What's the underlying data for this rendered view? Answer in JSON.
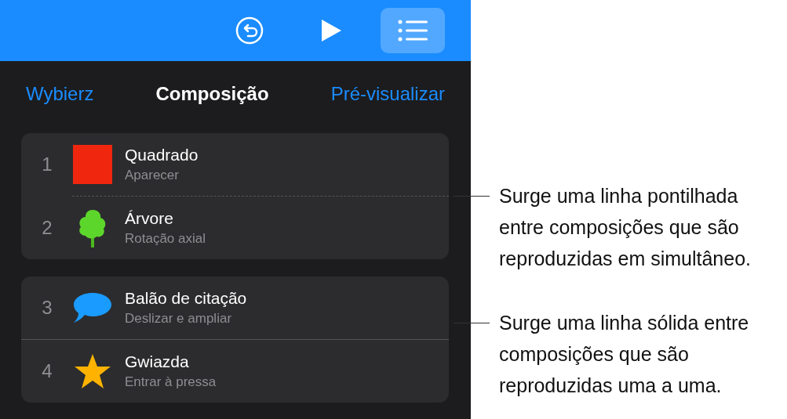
{
  "toolbar": {
    "buttons": [
      {
        "kind": "undo",
        "selected": false
      },
      {
        "kind": "play",
        "selected": false
      },
      {
        "kind": "list",
        "selected": true
      }
    ]
  },
  "nav": {
    "left": "Wybierz",
    "title": "Composição",
    "right": "Pré-visualizar"
  },
  "groups": [
    {
      "dotted_separator": true,
      "items": [
        {
          "number": "1",
          "kind": "square",
          "title": "Quadrado",
          "effect": "Aparecer"
        },
        {
          "number": "2",
          "kind": "tree",
          "title": "Árvore",
          "effect": "Rotação axial"
        }
      ]
    },
    {
      "dotted_separator": false,
      "items": [
        {
          "number": "3",
          "kind": "bubble",
          "title": "Balão de citação",
          "effect": "Deslizar e ampliar"
        },
        {
          "number": "4",
          "kind": "star",
          "title": "Gwiazda",
          "effect": "Entrar à pressa"
        }
      ]
    }
  ],
  "callouts": [
    "Surge uma linha pontilhada entre composições que são reproduzidas em simultâneo.",
    "Surge uma linha sólida entre composições que são reproduzidas uma a uma."
  ]
}
